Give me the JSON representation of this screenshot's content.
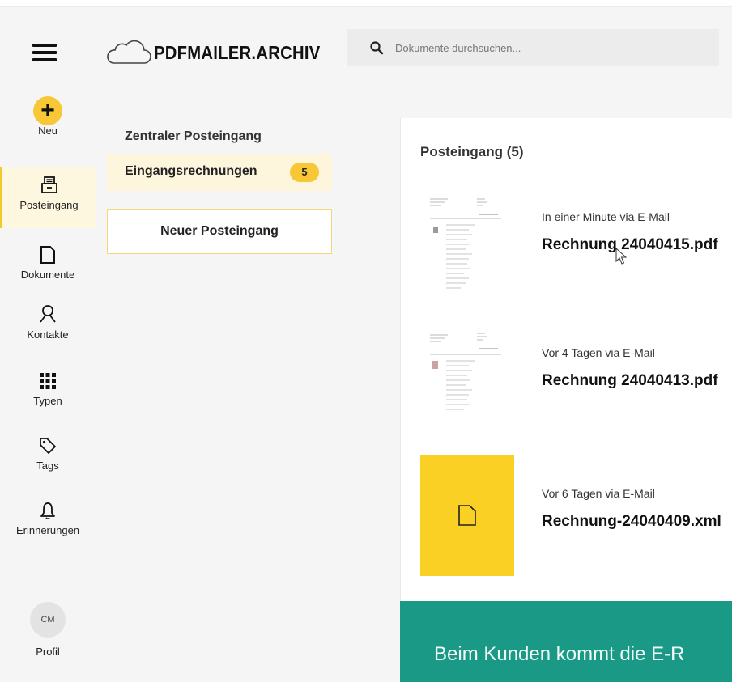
{
  "header": {
    "logo_text": "PDFMAILER.ARCHIV",
    "search_placeholder": "Dokumente durchsuchen..."
  },
  "nav": {
    "items": [
      {
        "label": "Neu",
        "icon": "plus-icon"
      },
      {
        "label": "Posteingang",
        "icon": "inbox-icon",
        "active": true
      },
      {
        "label": "Dokumente",
        "icon": "document-icon"
      },
      {
        "label": "Kontakte",
        "icon": "contact-icon"
      },
      {
        "label": "Typen",
        "icon": "grid-icon"
      },
      {
        "label": "Tags",
        "icon": "tag-icon"
      },
      {
        "label": "Erinnerungen",
        "icon": "bell-icon"
      }
    ],
    "profile": {
      "initials": "CM",
      "label": "Profil"
    }
  },
  "inboxes": {
    "title": "Zentraler Posteingang",
    "items": [
      {
        "label": "Eingangsrechnungen",
        "count": "5"
      }
    ],
    "new_button": "Neuer Posteingang"
  },
  "main": {
    "title": "Posteingang (5)",
    "documents": [
      {
        "meta": "In einer Minute via E-Mail",
        "name": "Rechnung 24040415.pdf",
        "thumb": "pdf-preview"
      },
      {
        "meta": "Vor 4 Tagen via E-Mail",
        "name": "Rechnung 24040413.pdf",
        "thumb": "pdf-preview"
      },
      {
        "meta": "Vor 6 Tagen via E-Mail",
        "name": "Rechnung-24040409.xml",
        "thumb": "file-icon"
      }
    ]
  },
  "banner": {
    "text": "Beim Kunden kommt die E-R"
  },
  "colors": {
    "accent": "#f7c735",
    "accent_light": "#fdf6dc",
    "banner": "#1b9987"
  }
}
